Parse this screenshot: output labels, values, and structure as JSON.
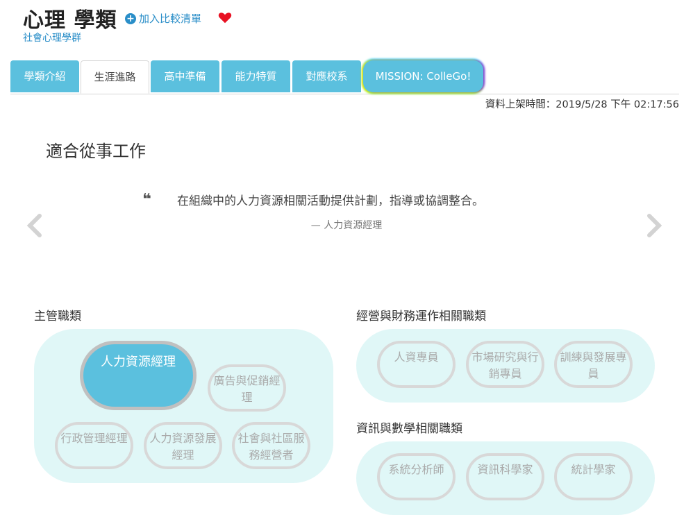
{
  "header": {
    "title": "心理 學類",
    "add_compare": "加入比較清單",
    "subtitle": "社會心理學群"
  },
  "tabs": [
    {
      "label": "學類介紹"
    },
    {
      "label": "生涯進路"
    },
    {
      "label": "高中準備"
    },
    {
      "label": "能力特質"
    },
    {
      "label": "對應校系"
    },
    {
      "label": "MISSION: ColleGo!"
    }
  ],
  "active_tab": "生涯進路",
  "updated": "資料上架時間：2019/5/28 下午 02:17:56",
  "section_title": "適合從事工作",
  "quote": {
    "text": "在組織中的人力資源相關活動提供計劃，指導或協調整合。",
    "author": "— 人力資源經理"
  },
  "groups": {
    "management": {
      "label": "主管職類",
      "jobs": [
        "人力資源經理",
        "廣告與促銷經理",
        "行政管理經理",
        "人力資源發展經理",
        "社會與社區服務經營者"
      ]
    },
    "business": {
      "label": "經營與財務運作相關職類",
      "jobs": [
        "人資專員",
        "市場研究與行銷專員",
        "訓練與發展專員"
      ]
    },
    "it": {
      "label": "資訊與數學相關職類",
      "jobs": [
        "系統分析師",
        "資訊科學家",
        "統計學家"
      ]
    }
  },
  "colors": {
    "accent": "#5bc0de",
    "link": "#2a8ec8",
    "heart": "#e81123",
    "panel": "#e0f7f7"
  },
  "icons": [
    "plus-circle-icon",
    "heart-icon",
    "quote-icon",
    "chevron-left-icon",
    "chevron-right-icon"
  ]
}
